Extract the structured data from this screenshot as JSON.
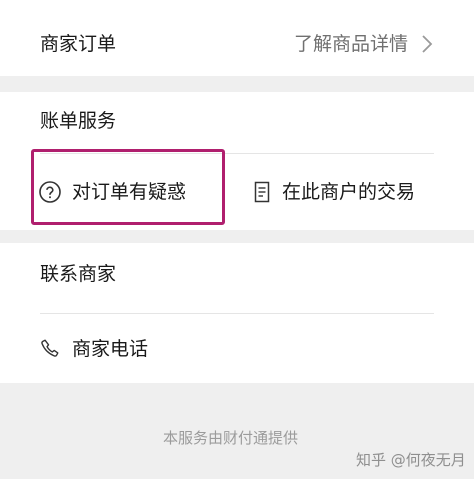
{
  "order_section": {
    "title": "商家订单",
    "link_label": "了解商品详情",
    "chevron_icon": "chevron-right-icon"
  },
  "bill_section": {
    "title": "账单服务",
    "question_label": "对订单有疑惑",
    "question_icon": "question-circle-icon",
    "transactions_label": "在此商户的交易",
    "transactions_icon": "document-icon"
  },
  "contact_section": {
    "title": "联系商家",
    "phone_label": "商家电话",
    "phone_icon": "phone-icon"
  },
  "footer": {
    "service_note": "本服务由财付通提供",
    "watermark": "知乎 @何夜无月"
  },
  "colors": {
    "background": "#efefef",
    "card": "#ffffff",
    "text_primary": "#1a1a1a",
    "text_secondary": "#707070",
    "highlight": "#b01f6e"
  }
}
